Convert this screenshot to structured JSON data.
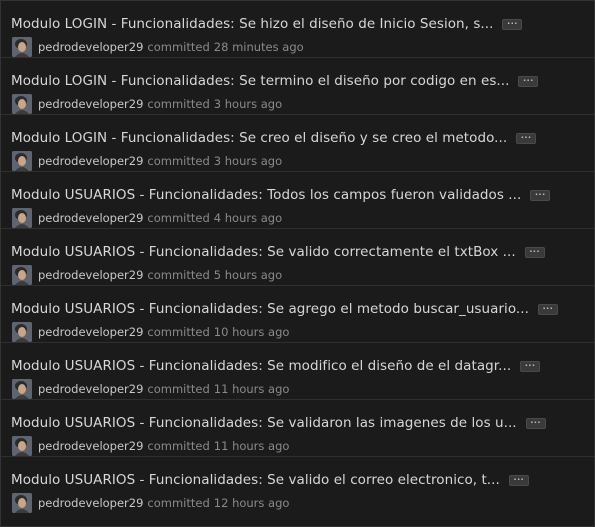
{
  "more_label": "···",
  "avatar_icon": "user-avatar-icon",
  "commits": [
    {
      "message": "Modulo LOGIN - Funcionalidades: Se hizo el diseño de Inicio Sesion, s...",
      "author": "pedrodeveloper29",
      "verb": "committed",
      "time": "28 minutes ago"
    },
    {
      "message": "Modulo LOGIN - Funcionalidades: Se termino el diseño por codigo en es...",
      "author": "pedrodeveloper29",
      "verb": "committed",
      "time": "3 hours ago"
    },
    {
      "message": "Modulo LOGIN - Funcionalidades: Se creo el diseño y se creo el metodo...",
      "author": "pedrodeveloper29",
      "verb": "committed",
      "time": "3 hours ago"
    },
    {
      "message": "Modulo USUARIOS - Funcionalidades: Todos los campos fueron validados ...",
      "author": "pedrodeveloper29",
      "verb": "committed",
      "time": "4 hours ago"
    },
    {
      "message": "Modulo USUARIOS - Funcionalidades: Se valido correctamente el txtBox ...",
      "author": "pedrodeveloper29",
      "verb": "committed",
      "time": "5 hours ago"
    },
    {
      "message": "Modulo USUARIOS - Funcionalidades: Se agrego el metodo buscar_usuario...",
      "author": "pedrodeveloper29",
      "verb": "committed",
      "time": "10 hours ago"
    },
    {
      "message": "Modulo USUARIOS - Funcionalidades: Se modifico el diseño de el datagr...",
      "author": "pedrodeveloper29",
      "verb": "committed",
      "time": "11 hours ago"
    },
    {
      "message": "Modulo USUARIOS - Funcionalidades: Se validaron las imagenes de los u...",
      "author": "pedrodeveloper29",
      "verb": "committed",
      "time": "11 hours ago"
    },
    {
      "message": "Modulo USUARIOS - Funcionalidades: Se valido el correo electronico, t...",
      "author": "pedrodeveloper29",
      "verb": "committed",
      "time": "12 hours ago"
    }
  ]
}
